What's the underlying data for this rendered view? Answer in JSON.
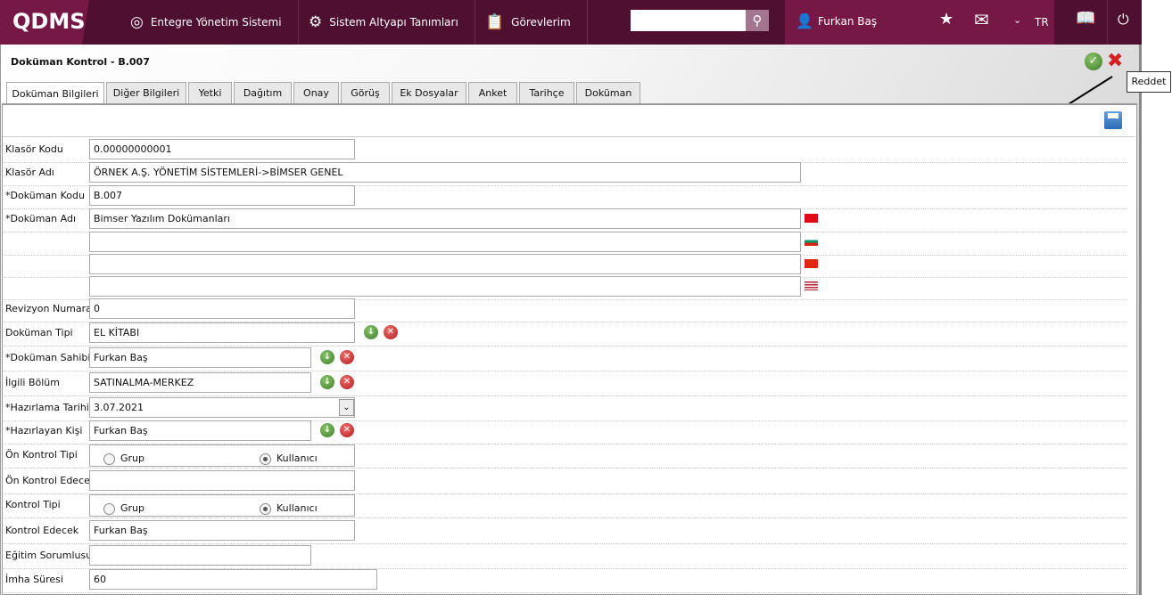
{
  "header": {
    "logo": "QDMS",
    "nav": [
      {
        "label": "Entegre Yönetim Sistemi",
        "icon": "q-logo-icon"
      },
      {
        "label": "Sistem Altyapı Tanımları",
        "icon": "gear-icon"
      },
      {
        "label": "Görevlerim",
        "icon": "clipboard-icon"
      }
    ],
    "search_value": "",
    "user": "Furkan Baş",
    "lang": "TR"
  },
  "page": {
    "title": "Doküman Kontrol - B.007",
    "tooltip": "Reddet",
    "tabs": [
      "Doküman Bilgileri",
      "Diğer Bilgileri",
      "Yetki",
      "Dağıtım",
      "Onay",
      "Görüş",
      "Ek Dosyalar",
      "Anket",
      "Tarihçe",
      "Doküman"
    ],
    "active_tab": 0
  },
  "form": [
    {
      "label": "Klasör Kodu",
      "value": "0.00000000001"
    },
    {
      "label": "Klasör Adı",
      "value": "ÖRNEK A.Ş. YÖNETİM SİSTEMLERİ->BİMSER GENEL"
    },
    {
      "label": "*Doküman Kodu",
      "value": "B.007"
    },
    {
      "label": "*Doküman Adı",
      "value": "Bimser Yazılım Dokümanları",
      "flag": "tr"
    },
    {
      "label": "",
      "value": "",
      "flag": "bg"
    },
    {
      "label": "",
      "value": "",
      "flag": "cn"
    },
    {
      "label": "",
      "value": "",
      "flag": "us"
    },
    {
      "label": "Revizyon Numarası",
      "value": "0"
    },
    {
      "label": "Doküman Tipi",
      "value": "EL KİTABI",
      "actions": true
    },
    {
      "label": "*Doküman Sahibi",
      "value": "Furkan Baş",
      "actions": true
    },
    {
      "label": "İlgili Bölüm",
      "value": "SATINALMA-MERKEZ",
      "actions": true
    },
    {
      "label": "*Hazırlama Tarihi",
      "value": "3.07.2021",
      "dropdown": true
    },
    {
      "label": "*Hazırlayan Kişi",
      "value": "Furkan Baş",
      "actions": true
    },
    {
      "label": "Ön Kontrol Tipi",
      "radio": [
        "Grup",
        "Kullanıcı"
      ],
      "selected": "Kullanıcı"
    },
    {
      "label": "Ön Kontrol Edecek",
      "value": ""
    },
    {
      "label": "Kontrol Tipi",
      "radio": [
        "Grup",
        "Kullanıcı"
      ],
      "selected": "Kullanıcı"
    },
    {
      "label": "Kontrol Edecek",
      "value": "Furkan Baş"
    },
    {
      "label": "Eğitim Sorumlusu",
      "value": ""
    },
    {
      "label": "İmha Süresi",
      "value": "60"
    }
  ],
  "colors": {
    "header_dark": "#4e0f30",
    "header_accent": "#761846",
    "approve": "#3e7d2a",
    "reject": "#b01818"
  }
}
